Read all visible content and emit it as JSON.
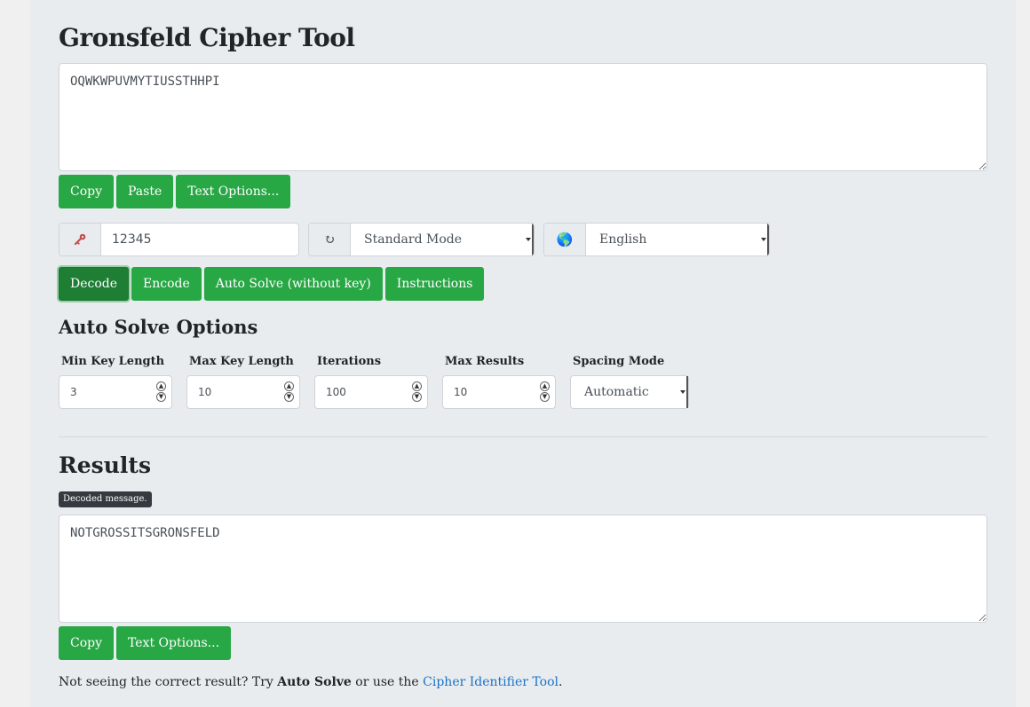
{
  "title": "Gronsfeld Cipher Tool",
  "input": {
    "value": "OQWKWPUVMYTIUSSTHHPI"
  },
  "input_buttons": {
    "copy": "Copy",
    "paste": "Paste",
    "text_options": "Text Options..."
  },
  "key_group": {
    "icon": "key-icon",
    "value": "12345"
  },
  "mode_group": {
    "icon": "refresh-icon",
    "glyph": "↻",
    "selected": "Standard Mode"
  },
  "language_group": {
    "icon": "globe-icon",
    "glyph": "🌎",
    "selected": "English"
  },
  "actions": {
    "decode": "Decode",
    "encode": "Encode",
    "auto_solve": "Auto Solve (without key)",
    "instructions": "Instructions"
  },
  "auto_solve_options": {
    "heading": "Auto Solve Options",
    "min_key_length": {
      "label": "Min Key Length",
      "value": "3"
    },
    "max_key_length": {
      "label": "Max Key Length",
      "value": "10"
    },
    "iterations": {
      "label": "Iterations",
      "value": "100"
    },
    "max_results": {
      "label": "Max Results",
      "value": "10"
    },
    "spacing_mode": {
      "label": "Spacing Mode",
      "selected": "Automatic"
    }
  },
  "results": {
    "heading": "Results",
    "badge": "Decoded message.",
    "value": "NOTGROSSITSGRONSFELD",
    "copy": "Copy",
    "text_options": "Text Options..."
  },
  "footnote": {
    "prefix": "Not seeing the correct result? Try ",
    "auto_solve": "Auto Solve",
    "middle": " or use the ",
    "link": "Cipher Identifier Tool",
    "suffix": "."
  },
  "colors": {
    "button": "#28a745",
    "button_active": "#1e7e34",
    "link": "#1a73c8",
    "panel": "#e9ecef"
  }
}
